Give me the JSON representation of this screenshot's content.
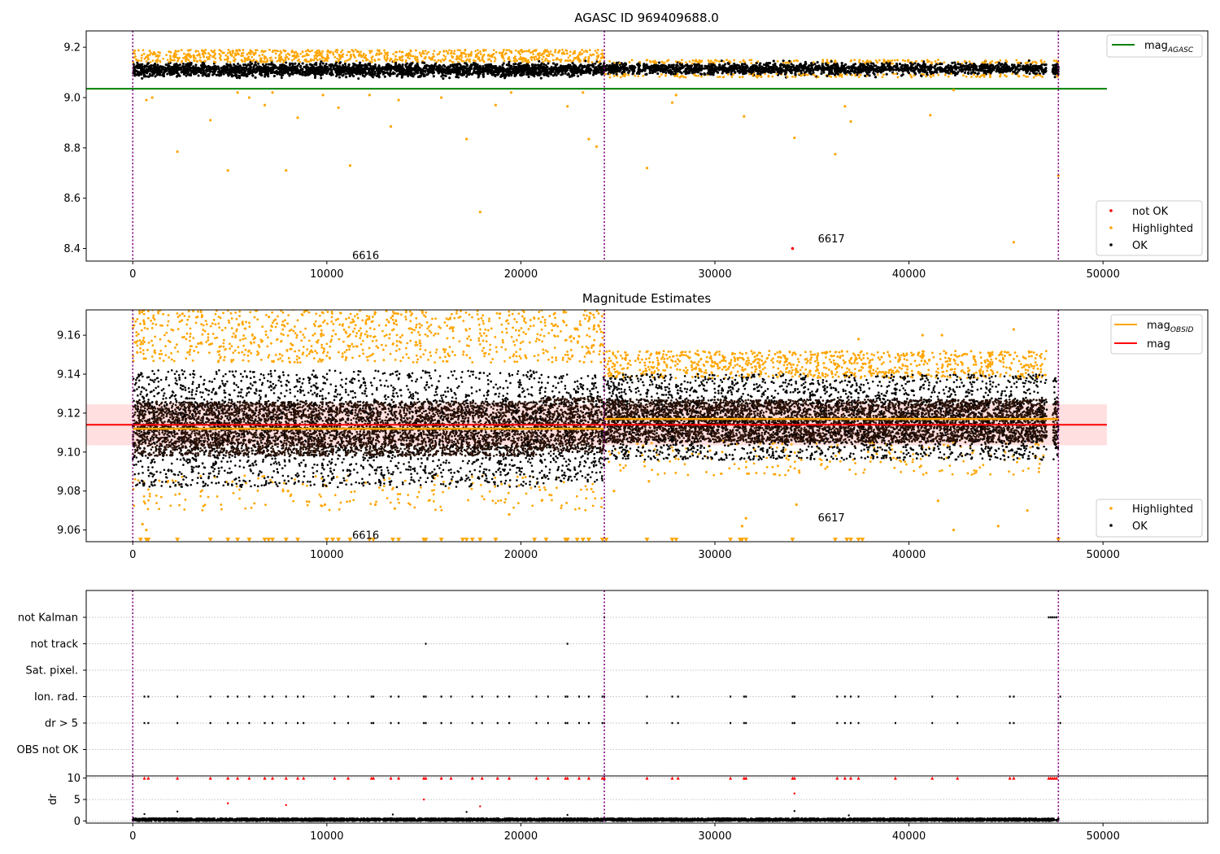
{
  "chart_data": [
    {
      "type": "scatter",
      "title": "AGASC ID 969409688.0",
      "xlim": [
        -2400,
        55400
      ],
      "ylim": [
        8.35,
        9.265
      ],
      "x_ticks": [
        0,
        10000,
        20000,
        30000,
        40000,
        50000
      ],
      "y_ticks": [
        8.4,
        8.6,
        8.8,
        9.0,
        9.2
      ],
      "y_tick_labels": [
        "8.4",
        "8.6",
        "8.8",
        "9.0",
        "9.2"
      ],
      "x_tick_labels": [
        "0",
        "10000",
        "20000",
        "30000",
        "40000",
        "50000"
      ],
      "grid": false,
      "legend_top": {
        "placement": "top-right",
        "entries": [
          {
            "label": "mag",
            "subscript": "AGASC",
            "color": "#008000"
          }
        ]
      },
      "legend_bottom": {
        "placement": "bottom-right",
        "entries": [
          {
            "label": "not OK",
            "color": "#ff0000"
          },
          {
            "label": "Highlighted",
            "color": "#ffa500"
          },
          {
            "label": "OK",
            "color": "#000000"
          }
        ]
      },
      "mag_agasc": {
        "value": 9.035,
        "x_range": [
          -2400,
          50200
        ],
        "color": "#008000"
      },
      "obsid_boundaries": [
        0,
        24300,
        47700
      ],
      "obsid_labels": [
        {
          "text": "6616",
          "x": 12000,
          "y": 8.375
        },
        {
          "text": "6617",
          "x": 36000,
          "y": 8.44
        }
      ],
      "ok_band": [
        {
          "x_range": [
            0,
            24300
          ],
          "y_center": 9.11,
          "y_spread": 0.025
        },
        {
          "x_range": [
            24300,
            47100
          ],
          "y_center": 9.115,
          "y_spread": 0.022
        },
        {
          "x_range": [
            47400,
            47700
          ],
          "y_center": 9.113,
          "y_spread": 0.02
        }
      ],
      "highlighted_points": [
        {
          "x": 700,
          "y": 8.99
        },
        {
          "x": 1000,
          "y": 9.0
        },
        {
          "x": 2300,
          "y": 8.785
        },
        {
          "x": 4000,
          "y": 8.91
        },
        {
          "x": 4900,
          "y": 8.71
        },
        {
          "x": 5400,
          "y": 9.02
        },
        {
          "x": 6000,
          "y": 9.0
        },
        {
          "x": 6800,
          "y": 8.97
        },
        {
          "x": 7200,
          "y": 9.02
        },
        {
          "x": 7900,
          "y": 8.71
        },
        {
          "x": 8500,
          "y": 8.92
        },
        {
          "x": 9800,
          "y": 9.01
        },
        {
          "x": 10600,
          "y": 8.96
        },
        {
          "x": 11200,
          "y": 8.73
        },
        {
          "x": 12200,
          "y": 9.01
        },
        {
          "x": 13300,
          "y": 8.885
        },
        {
          "x": 13700,
          "y": 8.99
        },
        {
          "x": 15900,
          "y": 9.0
        },
        {
          "x": 17200,
          "y": 8.835
        },
        {
          "x": 17900,
          "y": 8.545
        },
        {
          "x": 18700,
          "y": 8.97
        },
        {
          "x": 19500,
          "y": 9.02
        },
        {
          "x": 22400,
          "y": 8.965
        },
        {
          "x": 23200,
          "y": 9.02
        },
        {
          "x": 23500,
          "y": 8.835
        },
        {
          "x": 23900,
          "y": 8.805
        },
        {
          "x": 26500,
          "y": 8.72
        },
        {
          "x": 27800,
          "y": 8.98
        },
        {
          "x": 28000,
          "y": 9.01
        },
        {
          "x": 31500,
          "y": 8.925
        },
        {
          "x": 34100,
          "y": 8.84
        },
        {
          "x": 36200,
          "y": 8.775
        },
        {
          "x": 36700,
          "y": 8.965
        },
        {
          "x": 37000,
          "y": 8.905
        },
        {
          "x": 41100,
          "y": 8.93
        },
        {
          "x": 42300,
          "y": 9.03
        },
        {
          "x": 45400,
          "y": 8.425
        },
        {
          "x": 47700,
          "y": 8.69
        }
      ],
      "not_ok_points": [
        {
          "x": 34000,
          "y": 8.4
        }
      ]
    },
    {
      "type": "scatter",
      "title": "Magnitude Estimates",
      "xlim": [
        -2400,
        55400
      ],
      "ylim": [
        9.054,
        9.173
      ],
      "x_ticks": [
        0,
        10000,
        20000,
        30000,
        40000,
        50000
      ],
      "y_ticks": [
        9.06,
        9.08,
        9.1,
        9.12,
        9.14,
        9.16
      ],
      "y_tick_labels": [
        "9.06",
        "9.08",
        "9.10",
        "9.12",
        "9.14",
        "9.16"
      ],
      "x_tick_labels": [
        "0",
        "10000",
        "20000",
        "30000",
        "40000",
        "50000"
      ],
      "grid": false,
      "legend_top": {
        "placement": "top-right",
        "entries": [
          {
            "label": "mag",
            "subscript": "OBSID",
            "color": "#ffa500"
          },
          {
            "label": "mag",
            "subscript": "",
            "color": "#ff0000"
          }
        ]
      },
      "legend_bottom": {
        "placement": "bottom-right",
        "entries": [
          {
            "label": "Highlighted",
            "color": "#ffa500"
          },
          {
            "label": "OK",
            "color": "#000000"
          }
        ]
      },
      "mag": {
        "value": 9.114,
        "x_range": [
          -2400,
          50200
        ],
        "band": [
          9.1035,
          9.1245
        ],
        "color": "#ff0000"
      },
      "mag_obsid": [
        {
          "value": 9.112,
          "x_range": [
            0,
            24300
          ]
        },
        {
          "value": 9.117,
          "x_range": [
            24300,
            47700
          ]
        }
      ],
      "obsid_boundaries": [
        0,
        24300,
        47700
      ],
      "obsid_labels": [
        {
          "text": "6616",
          "x": 12000,
          "y": 9.0575
        },
        {
          "text": "6617",
          "x": 36000,
          "y": 9.0665
        }
      ],
      "ok_segments": [
        {
          "x_range": [
            0,
            21000
          ],
          "y_range": [
            9.082,
            9.142
          ],
          "inner": [
            9.098,
            9.126
          ]
        },
        {
          "x_range": [
            21000,
            24300
          ],
          "y_range": [
            9.084,
            9.14
          ],
          "inner": [
            9.1,
            9.128
          ]
        },
        {
          "x_range": [
            24300,
            47100
          ],
          "y_range": [
            9.096,
            9.14
          ],
          "inner": [
            9.105,
            9.127
          ]
        },
        {
          "x_range": [
            47400,
            47700
          ],
          "y_range": [
            9.096,
            9.138
          ],
          "inner": [
            9.104,
            9.126
          ]
        }
      ],
      "highlighted_columns": [
        {
          "x_range": [
            0,
            24300
          ],
          "y_range": [
            9.146,
            9.175
          ]
        },
        {
          "x_range": [
            24300,
            47100
          ],
          "y_range": [
            9.138,
            9.152
          ]
        }
      ],
      "highlighted_points": [
        {
          "x": 24000,
          "y": 9.165
        },
        {
          "x": 30000,
          "y": 9.15
        },
        {
          "x": 33600,
          "y": 9.149
        },
        {
          "x": 37400,
          "y": 9.158
        },
        {
          "x": 40700,
          "y": 9.16
        },
        {
          "x": 41700,
          "y": 9.16
        },
        {
          "x": 45400,
          "y": 9.163
        },
        {
          "x": 24800,
          "y": 9.08
        },
        {
          "x": 26600,
          "y": 9.085
        },
        {
          "x": 31600,
          "y": 9.066
        },
        {
          "x": 31400,
          "y": 9.062
        },
        {
          "x": 34200,
          "y": 9.073
        },
        {
          "x": 41500,
          "y": 9.075
        },
        {
          "x": 42300,
          "y": 9.06
        },
        {
          "x": 44600,
          "y": 9.062
        },
        {
          "x": 46100,
          "y": 9.07
        },
        {
          "x": 500,
          "y": 9.063
        },
        {
          "x": 700,
          "y": 9.06
        },
        {
          "x": 9900,
          "y": 9.073
        },
        {
          "x": 12500,
          "y": 9.073
        },
        {
          "x": 19400,
          "y": 9.068
        },
        {
          "x": 13500,
          "y": 9.071
        },
        {
          "x": 8000,
          "y": 9.08
        }
      ],
      "clipped_low_markers": [
        400,
        700,
        800,
        2300,
        4000,
        4900,
        5400,
        6000,
        6800,
        7000,
        7200,
        7900,
        8500,
        10000,
        10300,
        10600,
        11200,
        12200,
        12400,
        13400,
        13700,
        15000,
        15100,
        15900,
        17000,
        17200,
        17500,
        17900,
        18700,
        20700,
        21300,
        22300,
        22400,
        22900,
        23200,
        23500,
        24200,
        24400,
        26500,
        27800,
        28000,
        30800,
        31300,
        31400,
        31600,
        34000,
        36200,
        36800,
        37000,
        37400,
        37600,
        47700
      ],
      "clipped_low_value": 9.055
    },
    {
      "type": "scatter",
      "title": "",
      "xlim": [
        -2400,
        55400
      ],
      "x_ticks": [
        0,
        10000,
        20000,
        30000,
        40000,
        50000
      ],
      "x_tick_labels": [
        "0",
        "10000",
        "20000",
        "30000",
        "40000",
        "50000"
      ],
      "flag_labels": [
        "not Kalman",
        "not track",
        "Sat. pixel.",
        "Ion. rad.",
        "dr > 5",
        "OBS not OK"
      ],
      "grid": true,
      "obsid_boundaries": [
        0,
        24300,
        47700
      ],
      "flags": {
        "not Kalman": [
          24300,
          47200,
          47300,
          47400,
          47500,
          47600
        ],
        "not track": [
          15100,
          22400
        ],
        "Sat. pixel.": [],
        "Ion. rad.": [
          600,
          800,
          2300,
          4000,
          4900,
          5400,
          6000,
          6800,
          7200,
          7900,
          8500,
          8800,
          10400,
          11100,
          12300,
          12400,
          13300,
          13700,
          15000,
          15100,
          15900,
          16400,
          17500,
          18000,
          18800,
          19400,
          20800,
          21400,
          22300,
          22400,
          23000,
          23500,
          24200,
          24300,
          26500,
          27800,
          28100,
          30800,
          31500,
          31600,
          34000,
          34100,
          36300,
          36700,
          37000,
          37400,
          39300,
          41200,
          42500,
          45200,
          45400,
          47800
        ],
        "dr > 5": [
          600,
          800,
          2300,
          4000,
          4900,
          5400,
          6000,
          6800,
          7200,
          7900,
          8500,
          8800,
          10400,
          11100,
          12300,
          12400,
          13300,
          13700,
          15000,
          15100,
          15900,
          16400,
          17500,
          18000,
          18800,
          19400,
          20800,
          21400,
          22300,
          22400,
          23000,
          23500,
          24200,
          24300,
          26500,
          27800,
          28100,
          30800,
          31500,
          31600,
          34000,
          34100,
          36300,
          36700,
          37000,
          37400,
          39300,
          41200,
          42500,
          45200,
          45400,
          47800
        ],
        "OBS not OK": []
      }
    },
    {
      "type": "scatter",
      "title": "",
      "ylabel": "dr",
      "xlim": [
        -2400,
        55400
      ],
      "ylim": [
        -0.5,
        10.5
      ],
      "x_ticks": [
        0,
        10000,
        20000,
        30000,
        40000,
        50000
      ],
      "x_tick_labels": [
        "0",
        "10000",
        "20000",
        "30000",
        "40000",
        "50000"
      ],
      "y_ticks": [
        0,
        5,
        10
      ],
      "y_tick_labels": [
        "0",
        "5",
        "10"
      ],
      "grid": true,
      "obsid_boundaries": [
        0,
        24300,
        47700
      ],
      "ok_band": {
        "x_range": [
          0,
          47700
        ],
        "y_range": [
          0,
          0.6
        ]
      },
      "ok_points": [
        {
          "x": 600,
          "y": 1.6
        },
        {
          "x": 2300,
          "y": 2.2
        },
        {
          "x": 13400,
          "y": 1.5
        },
        {
          "x": 17200,
          "y": 2.1
        },
        {
          "x": 22400,
          "y": 1.4
        },
        {
          "x": 34100,
          "y": 2.3
        },
        {
          "x": 36900,
          "y": 1.3
        }
      ],
      "clipped_high": [
        600,
        800,
        2300,
        4000,
        4900,
        5400,
        6000,
        6800,
        7200,
        7900,
        8500,
        8800,
        10400,
        11100,
        12300,
        12400,
        13300,
        13700,
        15000,
        15100,
        15900,
        16400,
        17500,
        18000,
        18800,
        19400,
        20800,
        21400,
        22300,
        22400,
        23000,
        23500,
        24200,
        24300,
        26500,
        27800,
        28100,
        30800,
        31500,
        31600,
        34000,
        34100,
        36300,
        36700,
        37000,
        37400,
        39300,
        41200,
        42500,
        45200,
        45400,
        47200,
        47300,
        47400,
        47500,
        47600
      ],
      "not_ok_points": [
        {
          "x": 4900,
          "y": 4.1
        },
        {
          "x": 7900,
          "y": 3.7
        },
        {
          "x": 15000,
          "y": 5.0
        },
        {
          "x": 17900,
          "y": 3.4
        },
        {
          "x": 34100,
          "y": 6.4
        }
      ]
    }
  ]
}
